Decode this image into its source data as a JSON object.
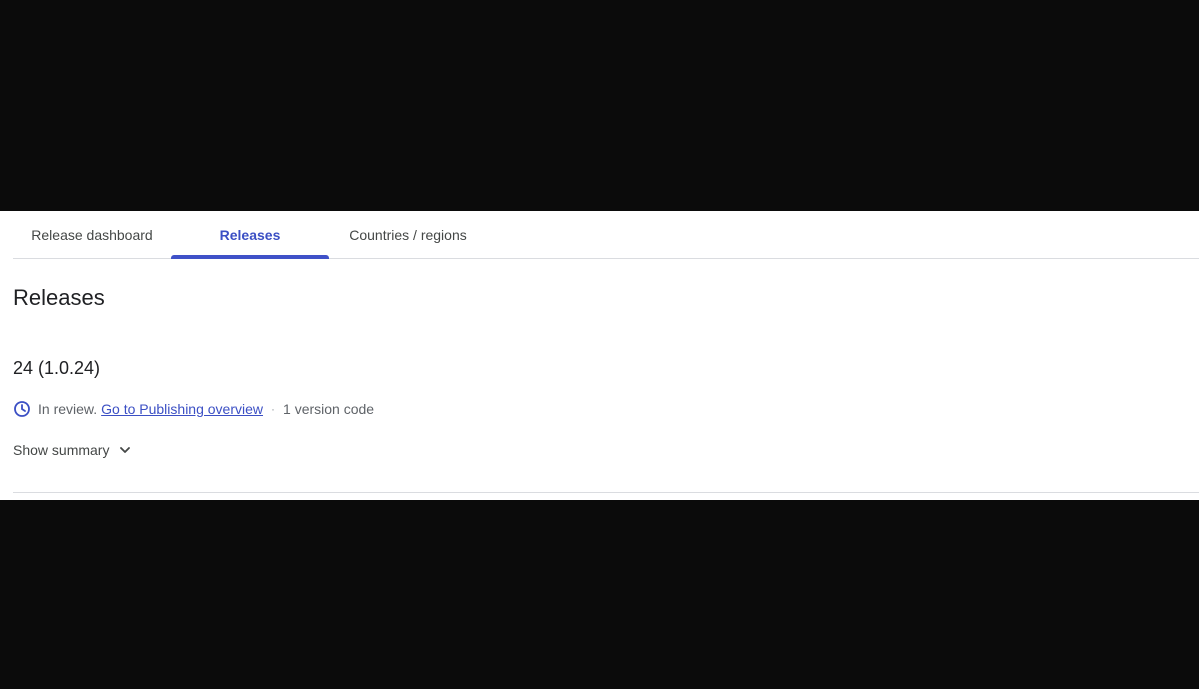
{
  "tabs": [
    {
      "label": "Release dashboard",
      "active": false
    },
    {
      "label": "Releases",
      "active": true
    },
    {
      "label": "Countries / regions",
      "active": false
    }
  ],
  "page_title": "Releases",
  "release": {
    "name": "24 (1.0.24)",
    "status": "In review.",
    "status_icon": "clock-icon",
    "link_text": "Go to Publishing overview",
    "separator": "·",
    "version_codes": "1 version code",
    "summary_toggle": "Show summary",
    "summary_icon": "chevron-down-icon"
  },
  "colors": {
    "accent": "#3f51c8",
    "link": "#3b4fc4",
    "text": "#202124",
    "muted": "#5f6368",
    "letterbox": "#0b0b0b"
  }
}
